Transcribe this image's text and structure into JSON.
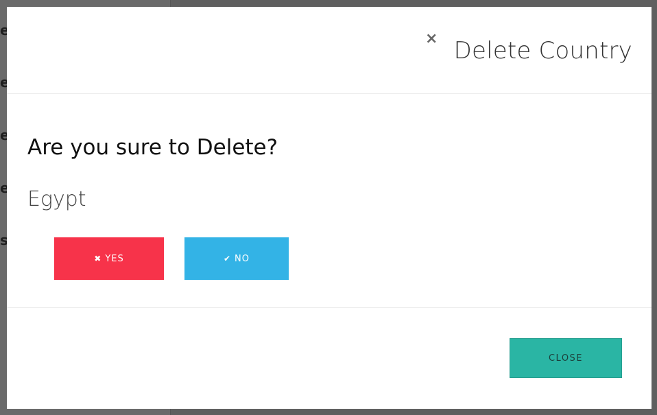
{
  "background": {
    "letters": [
      "e",
      "e",
      "e",
      "e",
      "s"
    ]
  },
  "modal": {
    "close_icon": "×",
    "title": "Delete Country",
    "question": "Are you sure to Delete?",
    "country_name": "Egypt",
    "yes_icon": "✖",
    "yes_label": "YES",
    "no_icon": "✔",
    "no_label": "NO",
    "close_label": "CLOSE"
  },
  "colors": {
    "yes_button": "#f7334a",
    "no_button": "#33b3e6",
    "close_button": "#2ab5a4",
    "backdrop": "#5f5f5f"
  }
}
